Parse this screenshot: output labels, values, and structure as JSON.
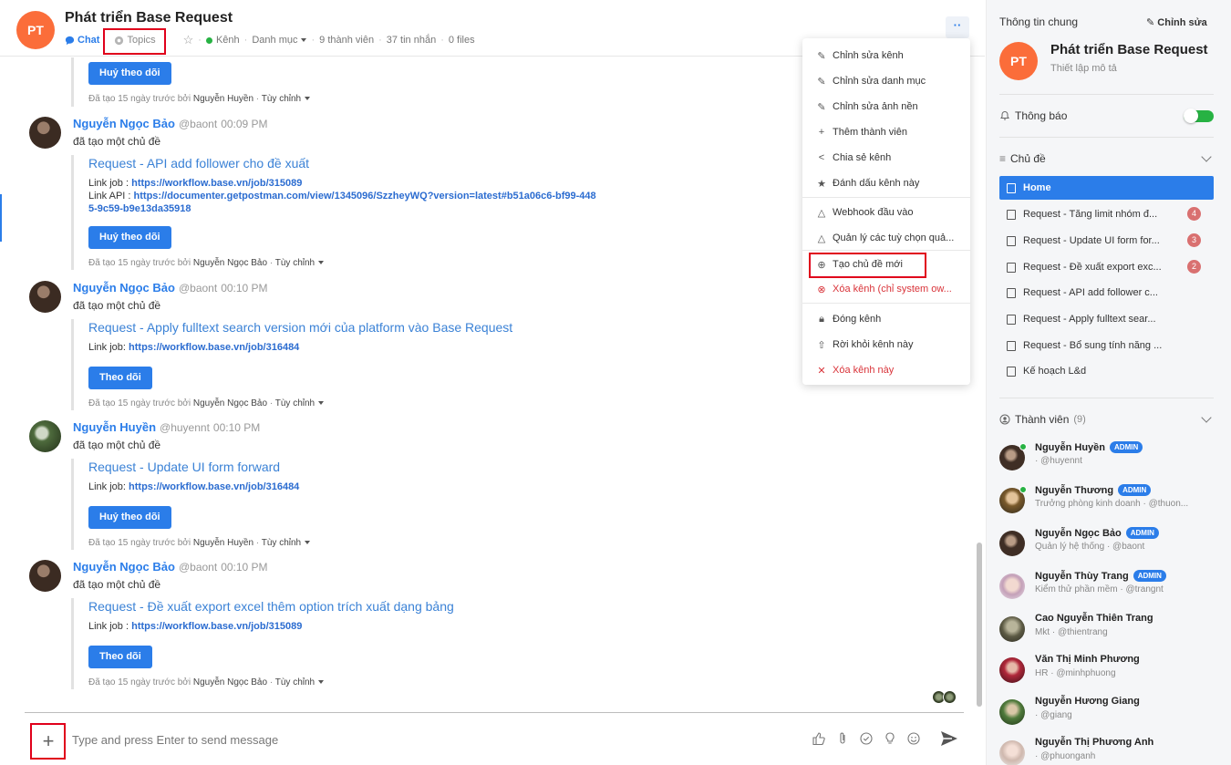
{
  "channel": {
    "initials": "PT",
    "title": "Phát triển Base Request",
    "tabs": {
      "chat": "Chat",
      "topics": "Topics"
    },
    "meta": {
      "type": "Kênh",
      "category": "Danh mục",
      "members": "9 thành viên",
      "messages": "37 tin nhắn",
      "files": "0 files"
    },
    "more": "··"
  },
  "feed": {
    "first_button": "Huỷ theo dõi",
    "first_footer": {
      "prefix": "Đã tạo 15 ngày trước bởi",
      "user": "Nguyễn Huyền",
      "custom": "Tùy chỉnh"
    },
    "messages": [
      {
        "author": "Nguyễn Ngọc Bảo",
        "handle": "@baont",
        "time": "00:09 PM",
        "action": "đã tạo một chủ đề",
        "topic": "Request - API add follower cho đề xuất",
        "links": [
          {
            "label": "Link job :",
            "url": "https://workflow.base.vn/job/315089"
          },
          {
            "label": "Link API :",
            "url": "https://documenter.getpostman.com/view/1345096/SzzheyWQ?version=latest#b51a06c6-bf99-4485-9c59-b9e13da35918"
          }
        ],
        "button": "Huỷ theo dõi",
        "footer": {
          "prefix": "Đã tạo 15 ngày trước bởi",
          "user": "Nguyễn Ngọc Bảo",
          "custom": "Tùy chỉnh"
        }
      },
      {
        "author": "Nguyễn Ngọc Bảo",
        "handle": "@baont",
        "time": "00:10 PM",
        "action": "đã tạo một chủ đề",
        "topic": "Request - Apply fulltext search version mới của platform vào Base Request",
        "links": [
          {
            "label": "Link job:",
            "url": "https://workflow.base.vn/job/316484"
          }
        ],
        "button": "Theo dõi",
        "footer": {
          "prefix": "Đã tạo 15 ngày trước bởi",
          "user": "Nguyễn Ngọc Bảo",
          "custom": "Tùy chỉnh"
        }
      },
      {
        "author": "Nguyễn Huyền",
        "handle": "@huyennt",
        "time": "00:10 PM",
        "action": "đã tạo một chủ đề",
        "topic": "Request - Update UI form forward",
        "links": [
          {
            "label": "Link job:",
            "url": "https://workflow.base.vn/job/316484"
          }
        ],
        "button": "Huỷ theo dõi",
        "footer": {
          "prefix": "Đã tạo 15 ngày trước bởi",
          "user": "Nguyễn Huyền",
          "custom": "Tùy chỉnh"
        }
      },
      {
        "author": "Nguyễn Ngọc Bảo",
        "handle": "@baont",
        "time": "00:10 PM",
        "action": "đã tạo một chủ đề",
        "topic": "Request - Đề xuất export excel thêm option trích xuất dạng bảng",
        "links": [
          {
            "label": "Link job :",
            "url": "https://workflow.base.vn/job/315089"
          }
        ],
        "button": "Theo dõi",
        "footer": {
          "prefix": "Đã tạo 15 ngày trước bởi",
          "user": "Nguyễn Ngọc Bảo",
          "custom": "Tùy chỉnh"
        }
      }
    ]
  },
  "composer": {
    "placeholder": "Type and press Enter to send message"
  },
  "menu": {
    "items": [
      "Chỉnh sửa kênh",
      "Chỉnh sửa danh mục",
      "Chỉnh sửa ảnh nền",
      "Thêm thành viên",
      "Chia sẻ kênh",
      "Đánh dấu kênh này",
      "Webhook đầu vào",
      "Quản lý các tuỳ chọn quả...",
      "Tạo chủ đề mới",
      "Xóa kênh (chỉ system ow...",
      "Đóng kênh",
      "Rời khỏi kênh này",
      "Xóa kênh này"
    ]
  },
  "panel": {
    "heading": "Thông tin chung",
    "edit": "Chỉnh sửa",
    "name": "Phát triển Base Request",
    "desc": "Thiết lập mô tả",
    "notify": "Thông báo",
    "topics_heading": "Chủ đề",
    "topics": [
      {
        "label": "Home",
        "badge": ""
      },
      {
        "label": "Request - Tăng limit nhóm đ...",
        "badge": "4"
      },
      {
        "label": "Request - Update UI form for...",
        "badge": "3"
      },
      {
        "label": "Request - Đề xuất export exc...",
        "badge": "2"
      },
      {
        "label": "Request - API add follower c...",
        "badge": ""
      },
      {
        "label": "Request - Apply fulltext sear...",
        "badge": ""
      },
      {
        "label": "Request - Bổ sung tính năng ...",
        "badge": ""
      },
      {
        "label": "Kế hoạch L&d",
        "badge": ""
      }
    ],
    "members_heading": "Thành viên",
    "members_count": "(9)",
    "admin_label": "ADMIN",
    "members": [
      {
        "name": "Nguyễn Huyền",
        "sub": "· @huyennt"
      },
      {
        "name": "Nguyễn Thương",
        "sub": "Trưởng phòng kinh doanh · @thuon..."
      },
      {
        "name": "Nguyễn Ngọc Bảo",
        "sub": "Quản lý hệ thống · @baont"
      },
      {
        "name": "Nguyễn Thùy Trang",
        "sub": "Kiểm thử phần mềm · @trangnt"
      },
      {
        "name": "Cao Nguyễn Thiên Trang",
        "sub": "Mkt · @thientrang"
      },
      {
        "name": "Văn Thị Minh Phương",
        "sub": "HR · @minhphuong"
      },
      {
        "name": "Nguyễn Hương Giang",
        "sub": "· @giang"
      },
      {
        "name": "Nguyễn Thị Phương Anh",
        "sub": "· @phuonganh"
      }
    ]
  }
}
